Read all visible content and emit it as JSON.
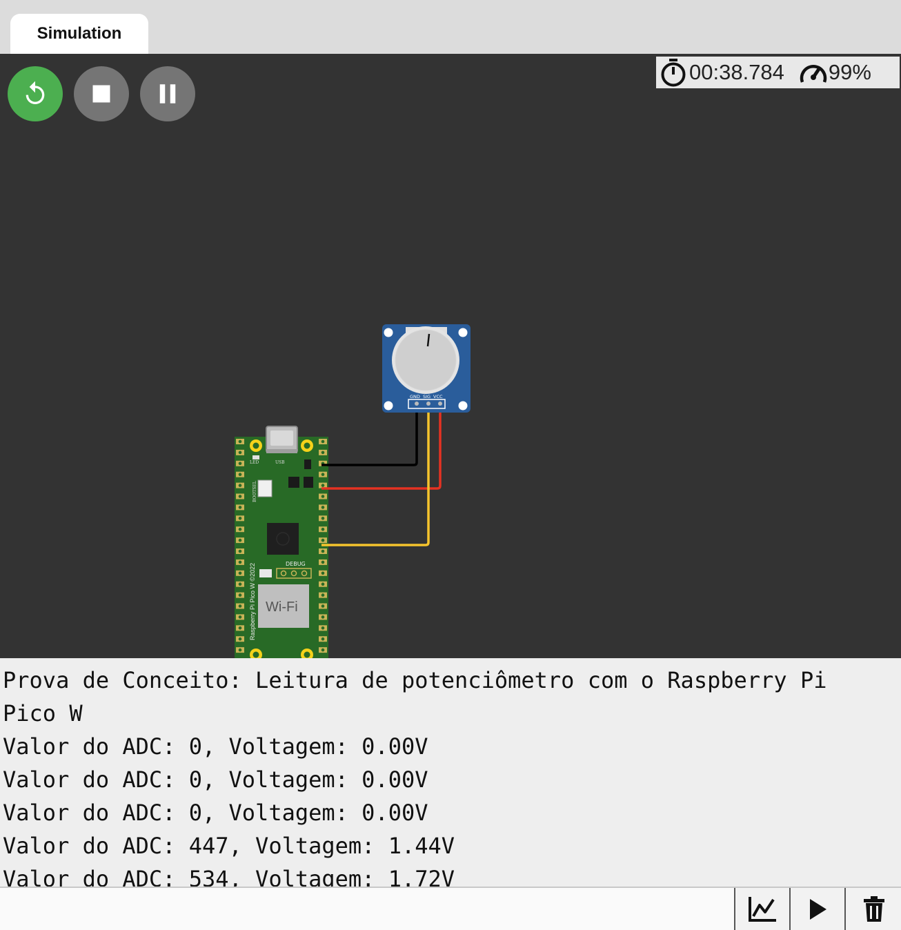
{
  "tabs": [
    {
      "label": "Simulation"
    }
  ],
  "controls": {
    "restart_icon": "restart-icon",
    "stop_icon": "stop-icon",
    "pause_icon": "pause-icon",
    "restart_color": "#4caf50",
    "neutral_color": "#757575"
  },
  "status": {
    "elapsed_time": "00:38.784",
    "speed": "99%"
  },
  "circuit": {
    "potentiometer": {
      "pins": [
        "GND",
        "SIG",
        "VCC"
      ]
    },
    "board": {
      "name": "Raspberry Pi Pico W ©2022",
      "labels": {
        "led": "LED",
        "usb": "USB",
        "bootsel": "BOOTSEL",
        "debug": "DEBUG",
        "wifi": "Wi-Fi"
      }
    },
    "wire_colors": {
      "gnd": "#000000",
      "vcc": "#e53222",
      "sig": "#f6c42d"
    }
  },
  "serial_monitor": {
    "lines": [
      "Prova de Conceito: Leitura de potenciômetro com o Raspberry Pi Pico W",
      "Valor do ADC: 0, Voltagem: 0.00V",
      "Valor do ADC: 0, Voltagem: 0.00V",
      "Valor do ADC: 0, Voltagem: 0.00V",
      "Valor do ADC: 447, Voltagem: 1.44V",
      "Valor do ADC: 534, Voltagem: 1.72V"
    ]
  },
  "toolbar": {
    "plotter_icon": "chart-icon",
    "play_icon": "play-icon",
    "clear_icon": "trash-icon"
  }
}
